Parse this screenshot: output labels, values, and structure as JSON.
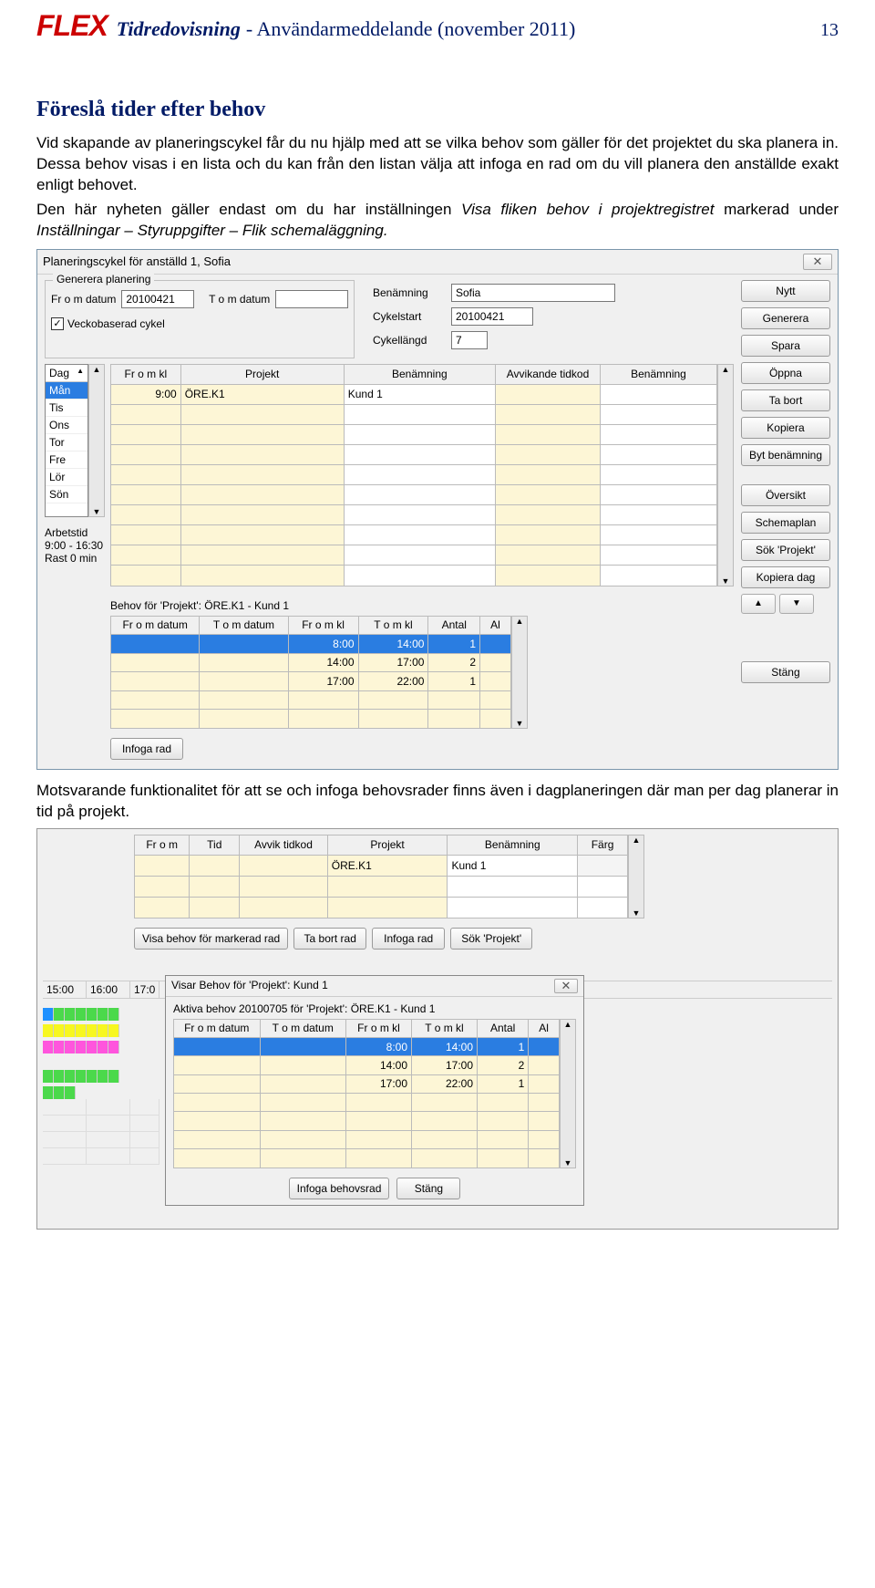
{
  "header": {
    "logo": "FLEX",
    "doc_title": "Tidredovisning",
    "doc_subtitle": " - Användarmeddelande (november 2011)",
    "page_number": "13"
  },
  "section": {
    "title": "Föreslå tider efter behov",
    "para1": "Vid skapande av planeringscykel får du nu hjälp med att se vilka behov som gäller för det projektet du ska planera in. Dessa behov visas i en lista och du kan från den listan välja att infoga en rad om du vill planera den anställde exakt enligt behovet.",
    "para2_pre": "Den här nyheten gäller endast om du har inställningen ",
    "para2_i1": "Visa fliken behov i projektregistret",
    "para2_mid": " markerad under ",
    "para2_i2": "Inställningar – Styruppgifter – Flik schemaläggning.",
    "para3": "Motsvarande funktionalitet för att se och infoga behovsrader finns även i dagplaneringen där man per dag planerar in tid på projekt."
  },
  "dialog1": {
    "title": "Planeringscykel för anställd 1, Sofia",
    "close": "✕",
    "group_generera": "Generera planering",
    "from_label": "Fr o m datum",
    "from_value": "20100421",
    "tom_label": "T o m datum",
    "tom_value": "",
    "veckobaserad": "Veckobaserad cykel",
    "benamning_label": "Benämning",
    "benamning_value": "Sofia",
    "cykelstart_label": "Cykelstart",
    "cykelstart_value": "20100421",
    "cykellangd_label": "Cykellängd",
    "cykellangd_value": "7",
    "day_header": "Dag",
    "days": [
      "Mån",
      "Tis",
      "Ons",
      "Tor",
      "Fre",
      "Lör",
      "Sön"
    ],
    "plan_headers": [
      "Fr o m kl",
      "Projekt",
      "Benämning",
      "Avvikande tidkod",
      "Benämning"
    ],
    "plan_row1": {
      "kl": "9:00",
      "projekt": "ÖRE.K1",
      "ben": "Kund 1"
    },
    "arbetstid_label": "Arbetstid",
    "arbetstid_value": "9:00 - 16:30",
    "rast_value": "Rast 0 min",
    "behov_title": "Behov för 'Projekt': ÖRE.K1 - Kund 1",
    "behov_headers": [
      "Fr o m datum",
      "T o m datum",
      "Fr o m kl",
      "T o m kl",
      "Antal",
      "Al"
    ],
    "behov_rows": [
      {
        "from": "",
        "tom": "",
        "fkl": "8:00",
        "tkl": "14:00",
        "antal": "1",
        "al": ""
      },
      {
        "from": "",
        "tom": "",
        "fkl": "14:00",
        "tkl": "17:00",
        "antal": "2",
        "al": ""
      },
      {
        "from": "",
        "tom": "",
        "fkl": "17:00",
        "tkl": "22:00",
        "antal": "1",
        "al": ""
      }
    ],
    "infoga_rad": "Infoga rad",
    "buttons": {
      "nytt": "Nytt",
      "generera": "Generera",
      "spara": "Spara",
      "oppna": "Öppna",
      "tabort": "Ta bort",
      "kopiera": "Kopiera",
      "bytben": "Byt benämning",
      "oversikt": "Översikt",
      "schemaplan": "Schemaplan",
      "sokprojekt": "Sök 'Projekt'",
      "kopieradag": "Kopiera dag",
      "stang": "Stäng"
    }
  },
  "dag": {
    "headers": [
      "Fr o m",
      "Tid",
      "Avvik tidkod",
      "Projekt",
      "Benämning",
      "Färg"
    ],
    "row": {
      "projekt": "ÖRE.K1",
      "benamning": "Kund 1"
    },
    "btns": {
      "visa": "Visa behov för markerad rad",
      "tabort": "Ta bort rad",
      "infoga": "Infoga rad",
      "sok": "Sök 'Projekt'"
    },
    "timeline": [
      "15:00",
      "16:00",
      "17:0"
    ],
    "popup_title": "Visar Behov för 'Projekt': Kund 1",
    "popup_sub": "Aktiva behov 20100705 för 'Projekt': ÖRE.K1 - Kund 1",
    "popup_headers": [
      "Fr o m datum",
      "T o m datum",
      "Fr o m kl",
      "T o m kl",
      "Antal",
      "Al"
    ],
    "popup_rows": [
      {
        "fkl": "8:00",
        "tkl": "14:00",
        "antal": "1"
      },
      {
        "fkl": "14:00",
        "tkl": "17:00",
        "antal": "2"
      },
      {
        "fkl": "17:00",
        "tkl": "22:00",
        "antal": "1"
      }
    ],
    "popup_btns": {
      "infoga": "Infoga behovsrad",
      "stang": "Stäng"
    }
  }
}
